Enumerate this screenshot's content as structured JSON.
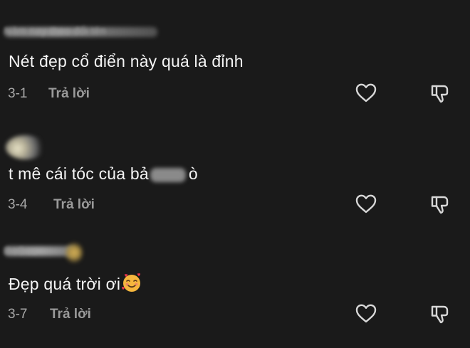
{
  "comments": [
    {
      "username": "Năm nay theo đổi tên",
      "text": "Nét đẹp cổ điển này quá là đỉnh",
      "date": "3-1",
      "reply_label": "Trả lời"
    },
    {
      "username": "",
      "text_before": "t mê cái tóc của bả",
      "text_after": "ò",
      "date": "3-4",
      "reply_label": "Trả lời"
    },
    {
      "username": "BaGau",
      "text": "Đẹp quá trời ơi",
      "date": "3-7",
      "reply_label": "Trả lời"
    }
  ],
  "icons": {
    "like": "heart-outline-icon",
    "dislike": "thumbs-down-outline-icon",
    "emoji": "smiling-face-with-hearts-emoji"
  },
  "colors": {
    "background": "#1a1a1a",
    "text": "#f4f4f4",
    "meta": "#a8a8a8"
  }
}
